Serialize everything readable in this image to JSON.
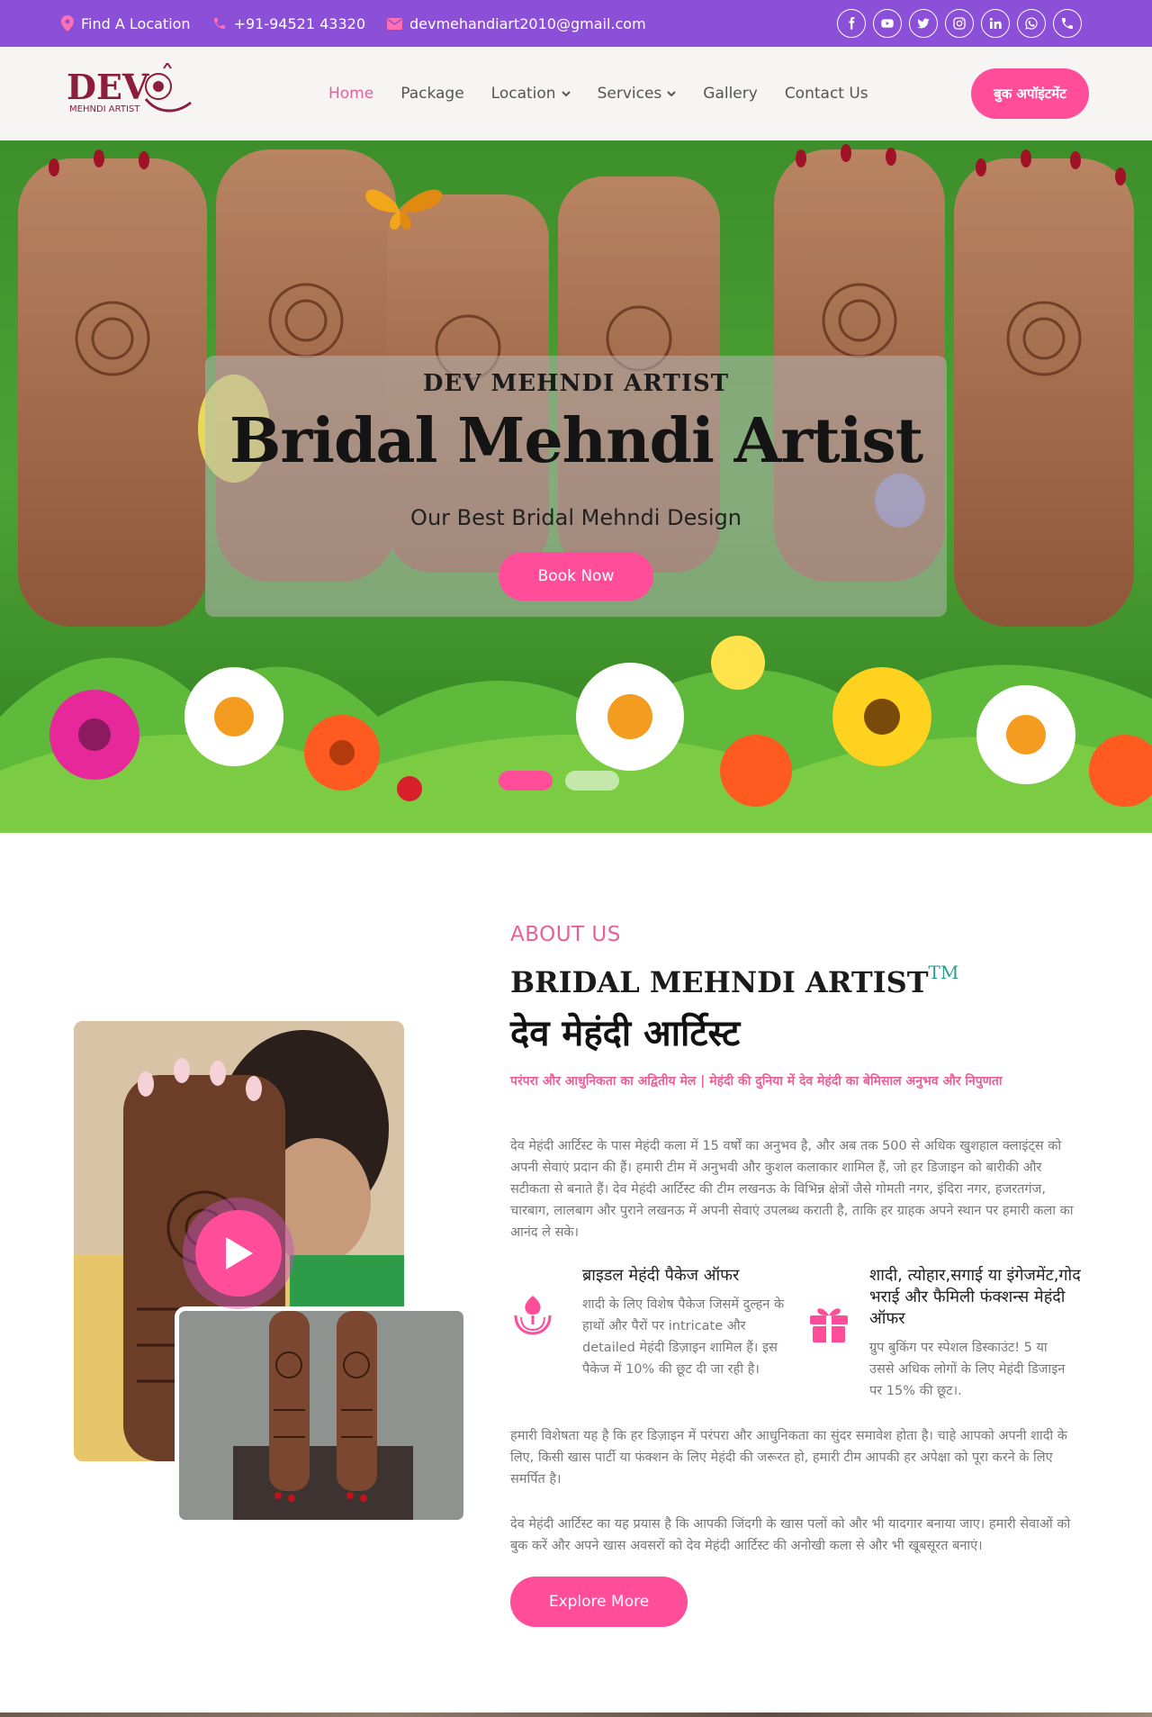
{
  "topbar": {
    "location": "Find A Location",
    "phone": "+91-94521 43320",
    "email": "devmehandiart2010@gmail.com",
    "social": [
      "facebook-icon",
      "youtube-icon",
      "twitter-icon",
      "instagram-icon",
      "linkedin-icon",
      "whatsapp-icon",
      "phone-icon"
    ]
  },
  "navbar": {
    "logo_main": "DEV",
    "logo_sub": "MEHNDI ARTIST",
    "links": [
      "Home",
      "Package",
      "Location",
      "Services",
      "Gallery",
      "Contact Us"
    ],
    "cta": "बुक अपॉइंटमेंट"
  },
  "hero": {
    "subtitle": "DEV MEHNDI ARTIST",
    "title": "Bridal Mehndi Artist",
    "tagline": "Our Best Bridal Mehndi Design",
    "button": "Book Now"
  },
  "about": {
    "label": "ABOUT US",
    "title": "BRIDAL MEHNDI ARTIST",
    "tm": "TM",
    "hindi_title": "देव मेहंदी आर्टिस्ट",
    "tagline": "परंपरा और आधुनिकता का अद्वितीय मेल | मेहंदी की दुनिया में देव मेहंदी का बेमिसाल अनुभव और निपुणता",
    "para1": "देव मेहंदी आर्टिस्ट के पास मेहंदी कला में 15 वर्षों का अनुभव है, और अब तक 500 से अधिक खुशहाल क्लाइंट्स को अपनी सेवाएं प्रदान की हैं। हमारी टीम में अनुभवी और कुशल कलाकार शामिल हैं, जो हर डिजाइन को बारीकी और सटीकता से बनाते हैं। देव मेहंदी आर्टिस्ट की टीम लखनऊ के विभिन्न क्षेत्रों जैसे गोमती नगर, इंदिरा नगर, हजरतगंज, चारबाग, लालबाग और पुराने लखनऊ में अपनी सेवाएं उपलब्ध कराती है, ताकि हर ग्राहक अपने स्थान पर हमारी कला का आनंद ले सके।",
    "feature1_title": "ब्राइडल मेहंदी पैकेज ऑफर",
    "feature1_text": "शादी के लिए विशेष पैकेज जिसमें दुल्हन के हाथों और पैरों पर intricate और detailed मेहंदी डिज़ाइन शामिल हैं। इस पैकेज में 10% की छूट दी जा रही है।",
    "feature2_title": "शादी, त्योहार,सगाई या इंगेजमेंट,गोद भराई और फैमिली फंक्शन्स मेहंदी ऑफर",
    "feature2_text": "ग्रुप बुकिंग पर स्पेशल डिस्काउंट! 5 या उससे अधिक लोगों के लिए मेहंदी डिजाइन पर 15% की छूट।.",
    "para2": "हमारी विशेषता यह है कि हर डिज़ाइन में परंपरा और आधुनिकता का सुंदर समावेश होता है। चाहे आपको अपनी शादी के लिए, किसी खास पार्टी या फंक्शन के लिए मेहंदी की जरूरत हो, हमारी टीम आपकी हर अपेक्षा को पूरा करने के लिए समर्पित है।",
    "para3": "देव मेहंदी आर्टिस्ट का यह प्रयास है कि आपकी जिंदगी के खास पलों को और भी यादगार बनाया जाए। हमारी सेवाओं को बुक करें और अपने खास अवसरों को देव मेहंदी आर्टिस्ट की अनोखी कला से और भी खूबसूरत बनाएं।",
    "button": "Explore More"
  },
  "colors": {
    "topbar": "#8c4fd8",
    "accent": "#ff4d9a",
    "accent_text": "#e8609a"
  }
}
